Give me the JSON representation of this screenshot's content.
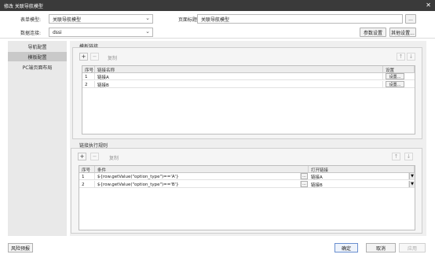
{
  "window": {
    "title": "修改 关联导航模型",
    "close_glyph": "✕"
  },
  "form": {
    "table_model_label": "表单模型:",
    "table_model_value": "关联导航模型",
    "page_title_label": "页面标题:",
    "page_title_value": "关联导航模型",
    "page_title_button": "...",
    "data_conn_label": "数据连接:",
    "data_conn_value": "dssi",
    "param_settings": "参数设置",
    "other_settings": "其他设置..."
  },
  "sidebar": {
    "items": [
      {
        "label": "导航配置"
      },
      {
        "label": "模板配置"
      },
      {
        "label": "PC端页面布局"
      }
    ],
    "active_index": 1
  },
  "template_links": {
    "legend": "模板链接",
    "add": "+",
    "remove": "−",
    "copy": "复制",
    "up": "↑",
    "down": "↓",
    "columns": [
      "序号",
      "链接名称",
      "设置"
    ],
    "rows": [
      {
        "no": "1",
        "name": "链接A",
        "action": "设置..."
      },
      {
        "no": "2",
        "name": "链接B",
        "action": "设置..."
      }
    ]
  },
  "link_rules": {
    "legend": "链接执行规则",
    "add": "+",
    "remove": "−",
    "copy": "复制",
    "up": "↑",
    "down": "↓",
    "columns": [
      "序号",
      "条件",
      "打开链接"
    ],
    "rows": [
      {
        "no": "1",
        "condition": "${row.getValue(\"option_type\")=='A'}",
        "more": "...",
        "link": "链接A",
        "arrow": "▼"
      },
      {
        "no": "2",
        "condition": "${row.getValue(\"option_type\")=='B'}",
        "more": "...",
        "link": "链接B",
        "arrow": "▼"
      }
    ]
  },
  "footer": {
    "preview": "风险预报",
    "ok": "确定",
    "cancel": "取消",
    "apply": "应用"
  }
}
